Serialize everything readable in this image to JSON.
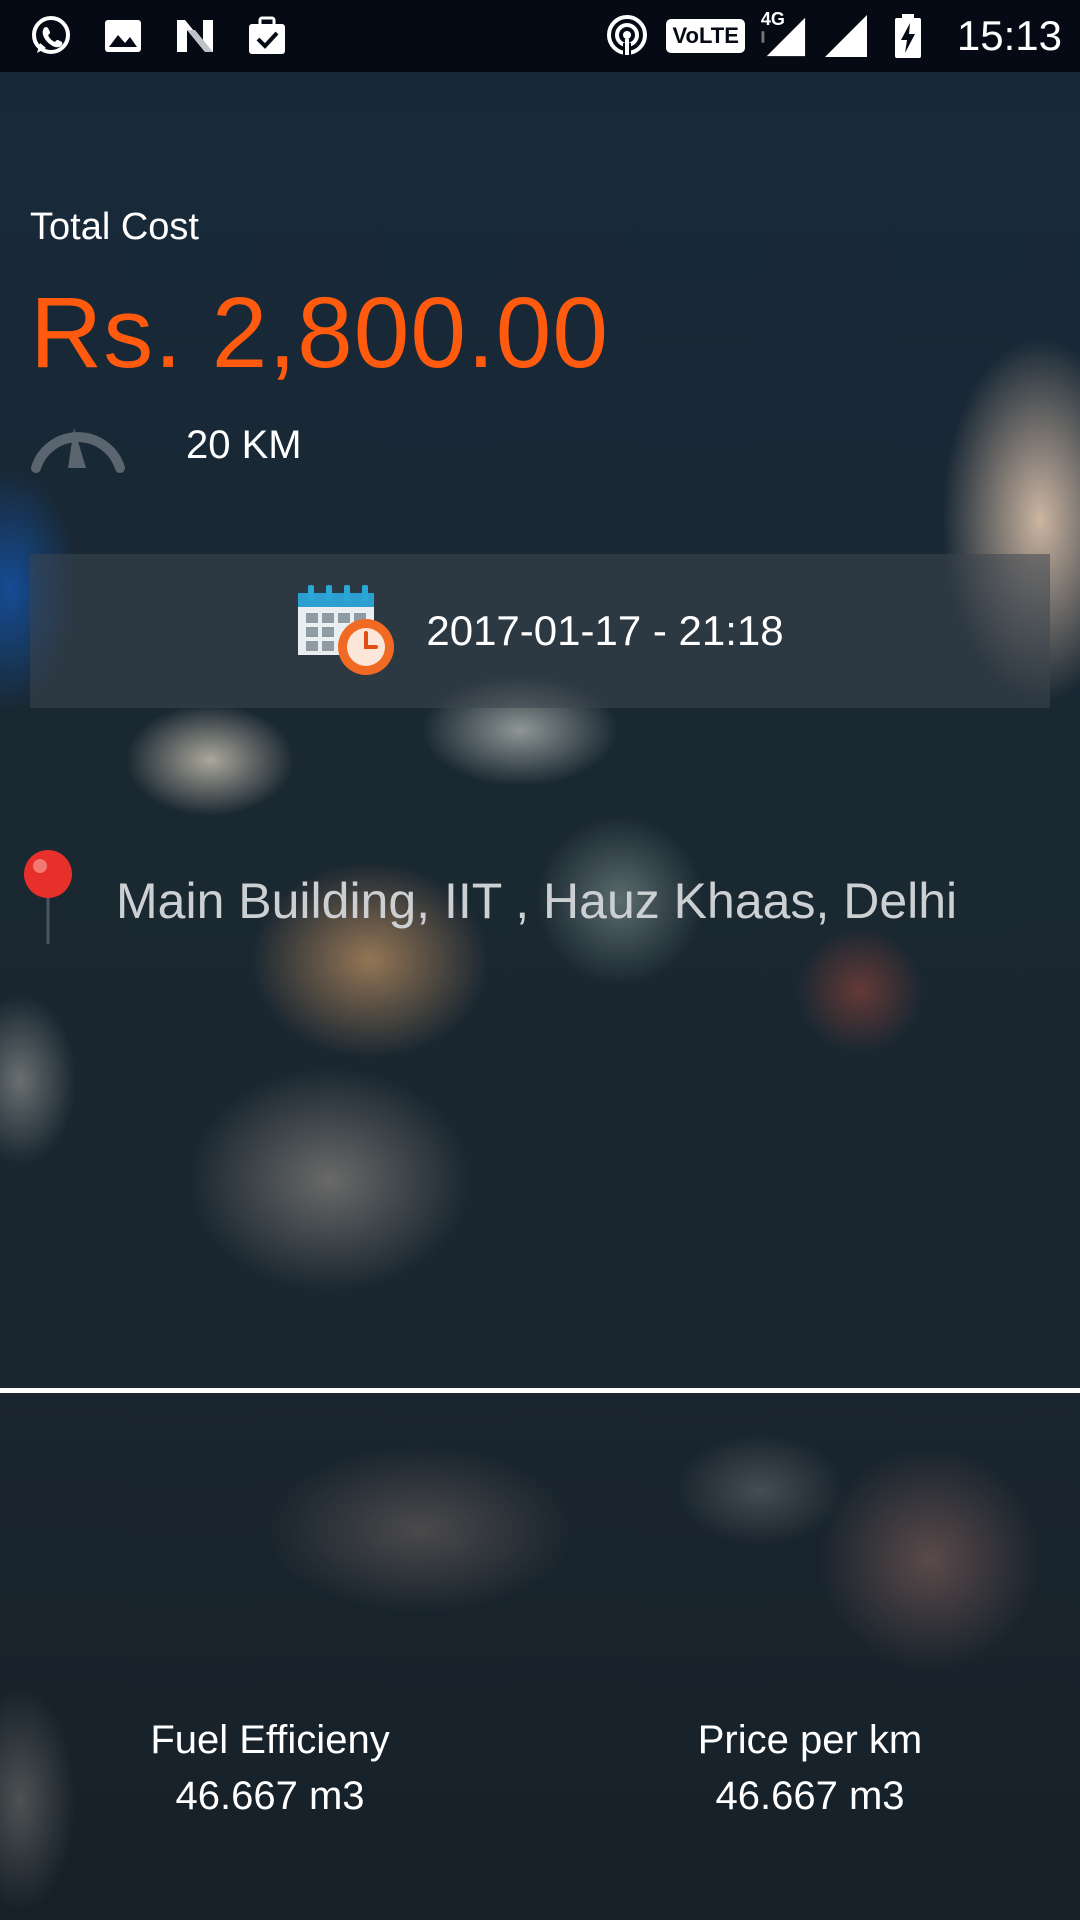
{
  "status_bar": {
    "time": "15:13",
    "volte_label": "VoLTE",
    "network_label": "4G",
    "left_icons": [
      "whatsapp-icon",
      "gallery-icon",
      "n-icon",
      "task-icon"
    ],
    "right_icons": [
      "hotspot-icon",
      "volte-icon",
      "signal-4g-icon",
      "signal-icon",
      "battery-charging-icon"
    ]
  },
  "summary": {
    "total_cost_label": "Total Cost",
    "total_cost_value": "Rs. 2,800.00",
    "distance": "20 KM",
    "speedometer_icon": "speedometer-icon"
  },
  "trip": {
    "datetime": "2017-01-17 - 21:18",
    "calendar_icon": "calendar-clock-icon",
    "location": "Main Building, IIT , Hauz Khaas, Delhi",
    "location_icon": "map-pin-icon"
  },
  "stats": {
    "fuel_efficiency_label": "Fuel Efficieny",
    "fuel_efficiency_value": "46.667 m3",
    "price_per_km_label": "Price per km",
    "price_per_km_value": "46.667 m3"
  },
  "colors": {
    "accent": "#ff5a0e",
    "status_bar_bg": "#050a14",
    "text": "#ffffff",
    "location_text": "#cdd0d2"
  }
}
